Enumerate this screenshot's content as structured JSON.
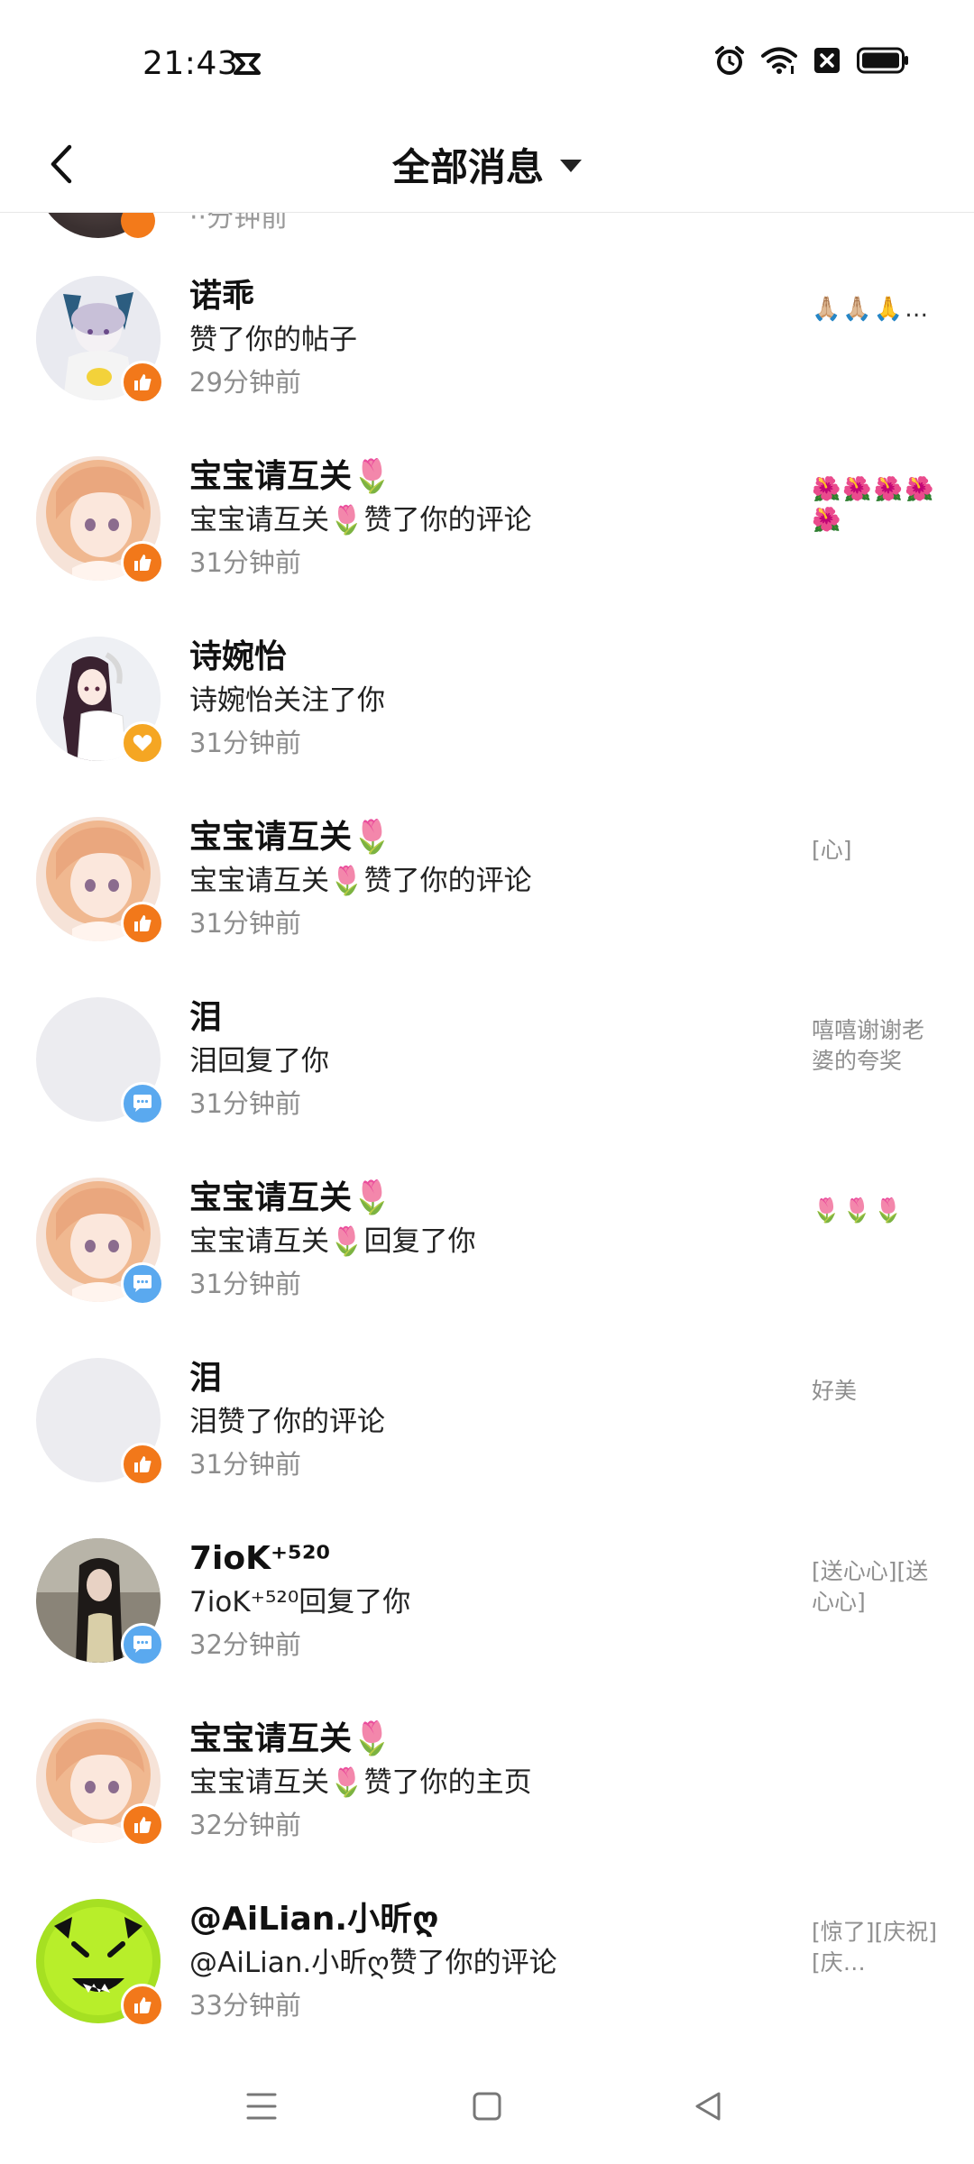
{
  "status_bar": {
    "time": "21:43",
    "app_icon": "capcut-icon",
    "icons": [
      "alarm-icon",
      "wifi-icon",
      "sim-blocked-icon",
      "battery-icon"
    ]
  },
  "header": {
    "back_icon": "back-arrow-icon",
    "title": "全部消息",
    "dropdown_icon": "caret-down-icon"
  },
  "partial_top": {
    "time": "··分钟前"
  },
  "messages": [
    {
      "name": "诺乖",
      "action": "赞了你的帖子",
      "time": "29分钟前",
      "preview": "🙏🏼🙏🏼🙏…",
      "badge": "like",
      "badge_icon": "thumbs-up-icon",
      "avatar": "anime-character-avatar"
    },
    {
      "name": "宝宝请互关🌷",
      "action": "宝宝请互关🌷赞了你的评论",
      "time": "31分钟前",
      "preview": "🌺🌺🌺🌺🌺",
      "badge": "like",
      "badge_icon": "thumbs-up-icon",
      "avatar": "anime-girl-avatar"
    },
    {
      "name": "诗婉怡",
      "action": "诗婉怡关注了你",
      "time": "31分钟前",
      "preview": "",
      "badge": "follow",
      "badge_icon": "heart-icon",
      "avatar": "anime-girl-long-hair-avatar"
    },
    {
      "name": "宝宝请互关🌷",
      "action": "宝宝请互关🌷赞了你的评论",
      "time": "31分钟前",
      "preview": "[心]",
      "badge": "like",
      "badge_icon": "thumbs-up-icon",
      "avatar": "anime-girl-avatar"
    },
    {
      "name": "泪",
      "action": "泪回复了你",
      "time": "31分钟前",
      "preview": "嘻嘻谢谢老婆的夸奖",
      "badge": "reply",
      "badge_icon": "chat-bubble-icon",
      "avatar": "blank-avatar"
    },
    {
      "name": "宝宝请互关🌷",
      "action": "宝宝请互关🌷回复了你",
      "time": "31分钟前",
      "preview": "🌷🌷🌷",
      "badge": "reply",
      "badge_icon": "chat-bubble-icon",
      "avatar": "anime-girl-avatar"
    },
    {
      "name": "泪",
      "action": "泪赞了你的评论",
      "time": "31分钟前",
      "preview": "好美",
      "badge": "like",
      "badge_icon": "thumbs-up-icon",
      "avatar": "blank-avatar"
    },
    {
      "name": "7ioK⁺⁵²⁰",
      "action": "7ioK⁺⁵²⁰回复了你",
      "time": "32分钟前",
      "preview": "[送心心][送心心]",
      "badge": "reply",
      "badge_icon": "chat-bubble-icon",
      "avatar": "photo-girl-avatar"
    },
    {
      "name": "宝宝请互关🌷",
      "action": "宝宝请互关🌷赞了你的主页",
      "time": "32分钟前",
      "preview": "",
      "badge": "like",
      "badge_icon": "thumbs-up-icon",
      "avatar": "anime-girl-avatar"
    },
    {
      "name": "@AiLian.小昕ღ",
      "action": "@AiLian.小昕ღ赞了你的评论",
      "time": "33分钟前",
      "preview": "[惊了][庆祝][庆…",
      "badge": "like",
      "badge_icon": "thumbs-up-icon",
      "avatar": "green-cartoon-avatar"
    }
  ],
  "nav": {
    "items": [
      "menu-icon",
      "home-icon",
      "back-icon"
    ]
  },
  "colors": {
    "like_badge": "#f2781a",
    "follow_badge": "#f5a623",
    "reply_badge": "#5aa9ef",
    "secondary_text": "#8d8d8d"
  }
}
